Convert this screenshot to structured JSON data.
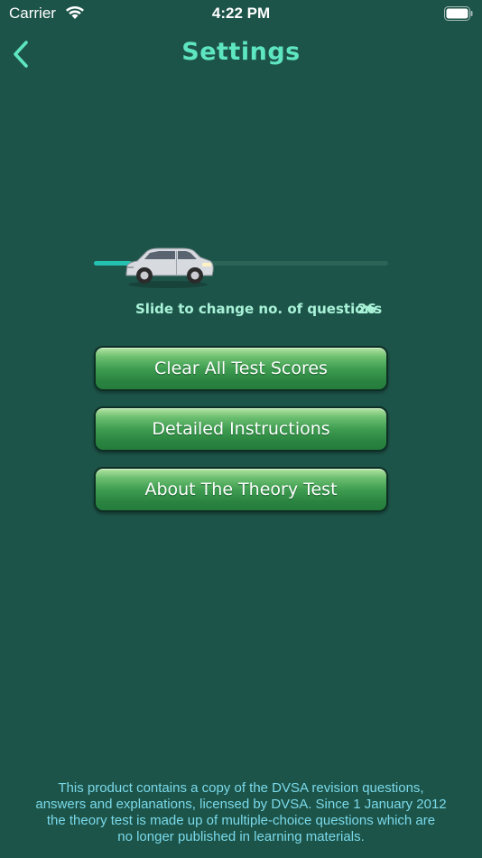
{
  "status_bar": {
    "carrier": "Carrier",
    "time": "4:22 PM"
  },
  "nav": {
    "title": "Settings",
    "back_icon": "chevron-left-icon"
  },
  "slider": {
    "caption": "Slide to change no. of questions",
    "value": "26",
    "position_fraction": 0.13,
    "thumb_icon": "car-icon"
  },
  "buttons": {
    "clear_scores": "Clear All Test Scores",
    "instructions": "Detailed Instructions",
    "about": "About The Theory Test"
  },
  "footer": {
    "line1": "This product contains a copy of the DVSA revision questions,",
    "line2": "answers and explanations, licensed by DVSA.  Since 1 January 2012",
    "line3": "the theory test is  made up of multiple-choice questions which are",
    "line4": "no longer published in learning materials."
  },
  "colors": {
    "background": "#1d5449",
    "accent": "#5ee5c2",
    "slider_fill": "#25c1b0",
    "button_green": "#3f9d51",
    "footer_text": "#7ad9ea"
  }
}
